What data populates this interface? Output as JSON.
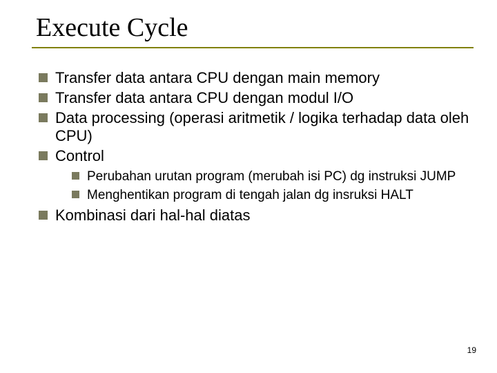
{
  "title": "Execute Cycle",
  "bullets": {
    "b0": "Transfer data antara CPU dengan main memory",
    "b1": "Transfer data antara CPU dengan modul I/O",
    "b2": "Data processing (operasi aritmetik / logika terhadap data oleh CPU)",
    "b3": "Control",
    "b3_sub0": "Perubahan urutan program (merubah isi PC) dg instruksi JUMP",
    "b3_sub1": "Menghentikan program di tengah jalan dg insruksi HALT",
    "b4": "Kombinasi dari hal-hal diatas"
  },
  "page_number": "19"
}
